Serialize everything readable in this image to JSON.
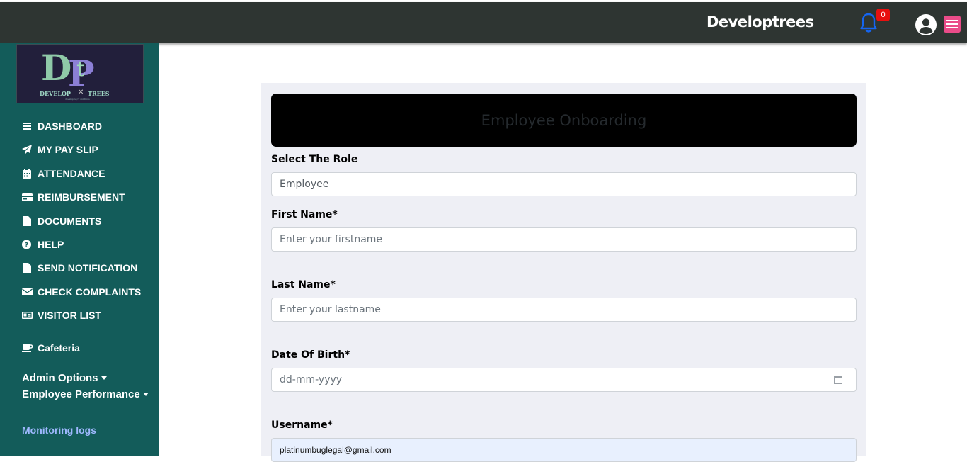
{
  "header": {
    "brand": "Developtrees",
    "notification_count": "0"
  },
  "sidebar": {
    "logo_text": "DEVELOP TREES",
    "items": [
      {
        "label": "DASHBOARD",
        "icon": "bars-icon"
      },
      {
        "label": "MY PAY SLIP",
        "icon": "paper-plane-icon"
      },
      {
        "label": "ATTENDANCE",
        "icon": "calendar-icon"
      },
      {
        "label": "REIMBURSEMENT",
        "icon": "credit-card-icon"
      },
      {
        "label": "DOCUMENTS",
        "icon": "file-icon"
      },
      {
        "label": "HELP",
        "icon": "question-circle-icon"
      },
      {
        "label": "SEND NOTIFICATION",
        "icon": "file-icon"
      },
      {
        "label": "CHECK COMPLAINTS",
        "icon": "envelope-icon"
      },
      {
        "label": "VISITOR LIST",
        "icon": "id-card-icon"
      }
    ],
    "cafeteria": "Cafeteria",
    "admin_options": "Admin Options",
    "employee_performance": "Employee Performance",
    "monitoring_logs": "Monitoring logs"
  },
  "form": {
    "title": "Employee Onboarding",
    "role_label": "Select The Role",
    "role_value": "Employee",
    "first_name_label": "First Name*",
    "first_name_placeholder": "Enter your firstname",
    "last_name_label": "Last Name*",
    "last_name_placeholder": "Enter your lastname",
    "dob_label": "Date Of Birth*",
    "dob_placeholder": "dd-mm-yyyy",
    "username_label": "Username*",
    "username_value": "platinumbuglegal@gmail.com"
  },
  "colors": {
    "topbar": "#2e3532",
    "sidebar": "#135c5a",
    "panel": "#eeeff5",
    "accent_bell": "#1565f0",
    "badge": "#e8100f",
    "hamburger": "#ea4c89",
    "monitoring_link": "#9fb9ff"
  }
}
